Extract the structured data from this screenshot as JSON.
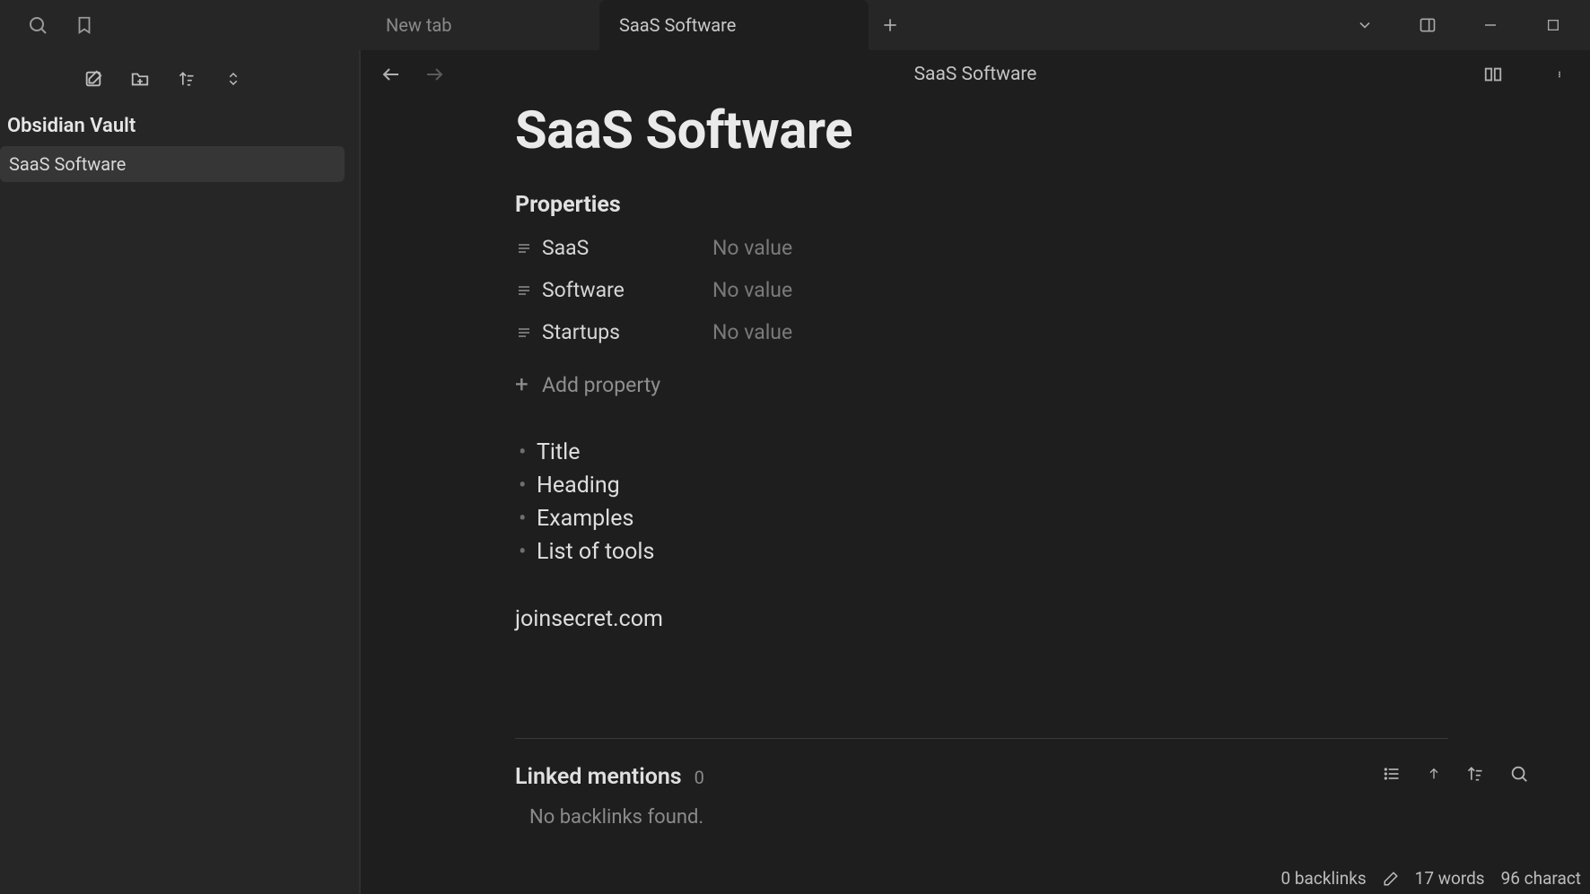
{
  "titlebar": {
    "tabs": [
      {
        "label": "New tab",
        "active": false
      },
      {
        "label": "SaaS Software",
        "active": true
      }
    ]
  },
  "sidebar": {
    "vault_name": "Obsidian Vault",
    "files": [
      {
        "name": "SaaS Software"
      }
    ]
  },
  "editor": {
    "header_title": "SaaS Software",
    "note_title": "SaaS Software",
    "properties_heading": "Properties",
    "properties": [
      {
        "key": "SaaS",
        "value": "No value"
      },
      {
        "key": "Software",
        "value": "No value"
      },
      {
        "key": "Startups",
        "value": "No value"
      }
    ],
    "add_property_label": "Add property",
    "bullets": [
      "Title",
      "Heading",
      "Examples",
      "List of tools"
    ],
    "link_text": "joinsecret.com"
  },
  "linked": {
    "heading": "Linked mentions",
    "count": "0",
    "empty_text": "No backlinks found."
  },
  "statusbar": {
    "backlinks": "0 backlinks",
    "words": "17 words",
    "chars": "96 charact"
  }
}
